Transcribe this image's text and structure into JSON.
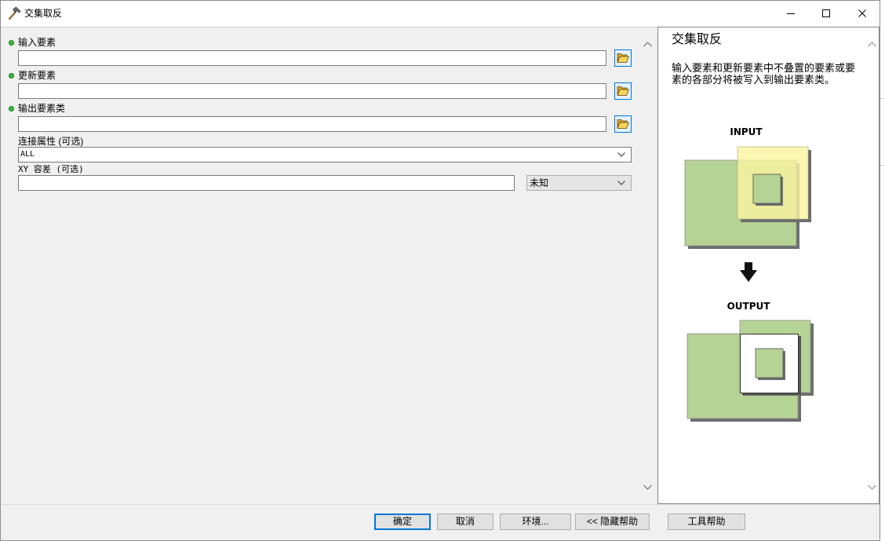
{
  "window": {
    "title": "交集取反",
    "icon": "hammer-icon",
    "controls": [
      "minimize-icon",
      "maximize-icon",
      "close-icon"
    ]
  },
  "form": {
    "input_features": {
      "label": "输入要素",
      "value": "",
      "required": true,
      "browse_icon": "open-folder-icon"
    },
    "update_features": {
      "label": "更新要素",
      "value": "",
      "required": true,
      "browse_icon": "open-folder-icon"
    },
    "output_feature_class": {
      "label": "输出要素类",
      "value": "",
      "required": true,
      "browse_icon": "open-folder-icon"
    },
    "join_attributes": {
      "label": "连接属性 (可选)",
      "selected": "ALL"
    },
    "xy_tolerance": {
      "label": "XY 容差 (可选)",
      "value": "",
      "unit_selected": "未知"
    }
  },
  "help": {
    "title": "交集取反",
    "description": "输入要素和更新要素中不叠置的要素或要素的各部分将被写入到输出要素类。",
    "diagram": {
      "input_label": "INPUT",
      "output_label": "OUTPUT",
      "arrow_icon": "arrow-down-icon"
    }
  },
  "buttons": {
    "ok": "确定",
    "cancel": "取消",
    "environments": "环境...",
    "hide_help": "<< 隐藏帮助",
    "tool_help": "工具帮助"
  },
  "colors": {
    "accent": "#0078d7",
    "required_dot": "#3cb83c",
    "diagram_green": "#b5d394",
    "diagram_yellow": "#faf5a0",
    "panel_bg": "#f0f0f0"
  }
}
